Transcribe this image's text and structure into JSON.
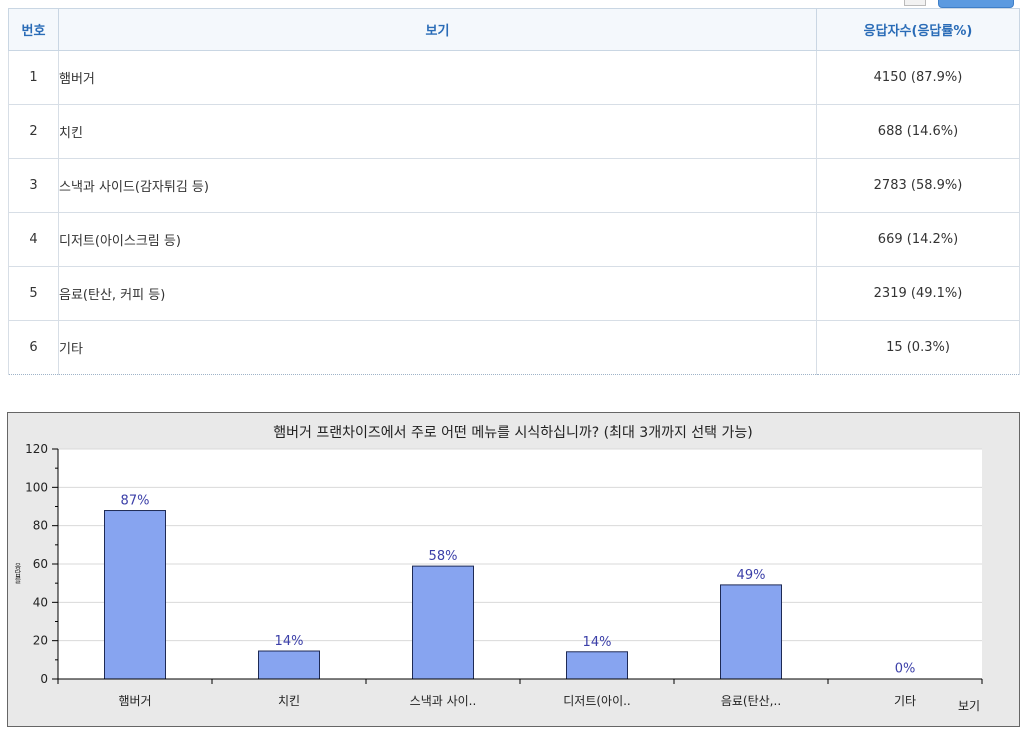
{
  "table": {
    "headers": {
      "num": "번호",
      "option": "보기",
      "count": "응답자수(응답률%)"
    },
    "rows": [
      {
        "num": "1",
        "label": "햄버거",
        "count": "4150 (87.9%)"
      },
      {
        "num": "2",
        "label": "치킨",
        "count": "688 (14.6%)"
      },
      {
        "num": "3",
        "label": "스낵과 사이드(감자튀김 등)",
        "count": "2783 (58.9%)"
      },
      {
        "num": "4",
        "label": "디저트(아이스크림 등)",
        "count": "669 (14.2%)"
      },
      {
        "num": "5",
        "label": "음료(탄산, 커피 등)",
        "count": "2319 (49.1%)"
      },
      {
        "num": "6",
        "label": "기타",
        "count": "15 (0.3%)"
      }
    ]
  },
  "chart_data": {
    "type": "bar",
    "title": "햄버거 프랜차이즈에서 주로 어떤 메뉴를 시식하십니까? (최대 3개까지 선택 가능)",
    "categories": [
      "햄버거",
      "치킨",
      "스낵과 사이..",
      "디저트(아이..",
      "음료(탄산,..",
      "기타"
    ],
    "values": [
      87.9,
      14.6,
      58.9,
      14.2,
      49.1,
      0.3
    ],
    "data_labels": [
      "87%",
      "14%",
      "58%",
      "14%",
      "49%",
      "0%"
    ],
    "xlabel": "보기",
    "ylabel": "응답률",
    "ylim": [
      0,
      120
    ],
    "yticks": [
      0,
      20,
      40,
      60,
      80,
      100,
      120
    ],
    "grid": true,
    "legend": "none",
    "bar_color": "#87a4f0",
    "bar_border": "#1e2a55",
    "label_color": "#3b3fa8"
  }
}
